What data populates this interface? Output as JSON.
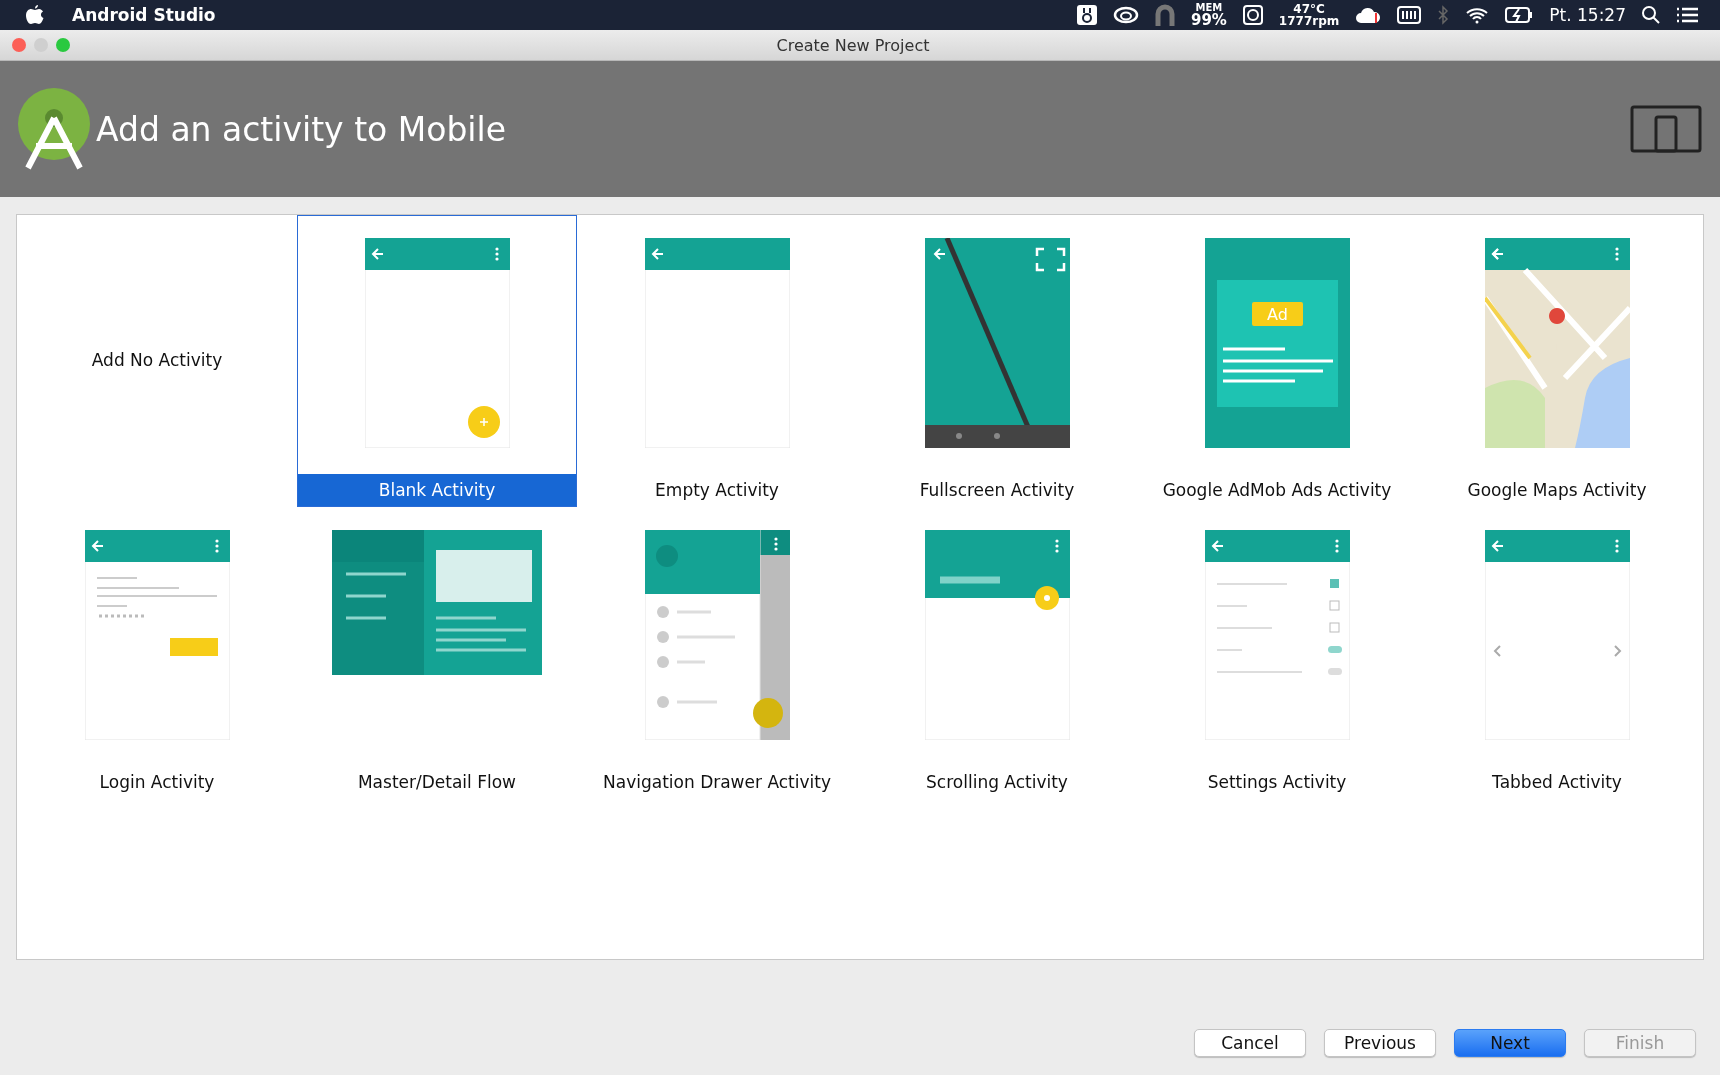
{
  "menu_bar": {
    "app_name": "Android Studio",
    "mem_label": "MEM",
    "mem_value": "99%",
    "temperature": "47°C",
    "fan_speed": "1777rpm",
    "clock": "Pt. 15:27"
  },
  "window": {
    "title": "Create New Project"
  },
  "header": {
    "title": "Add an activity to Mobile"
  },
  "templates": [
    {
      "label": "Add No Activity",
      "kind": "none",
      "selected": false
    },
    {
      "label": "Blank Activity",
      "kind": "blank",
      "selected": true
    },
    {
      "label": "Empty Activity",
      "kind": "empty",
      "selected": false
    },
    {
      "label": "Fullscreen Activity",
      "kind": "fullscreen",
      "selected": false
    },
    {
      "label": "Google AdMob Ads Activity",
      "kind": "admob",
      "selected": false,
      "badge": "Ad"
    },
    {
      "label": "Google Maps Activity",
      "kind": "maps",
      "selected": false
    },
    {
      "label": "Login Activity",
      "kind": "login",
      "selected": false
    },
    {
      "label": "Master/Detail Flow",
      "kind": "master_detail",
      "selected": false
    },
    {
      "label": "Navigation Drawer Activity",
      "kind": "nav_drawer",
      "selected": false
    },
    {
      "label": "Scrolling Activity",
      "kind": "scrolling",
      "selected": false
    },
    {
      "label": "Settings Activity",
      "kind": "settings",
      "selected": false
    },
    {
      "label": "Tabbed Activity",
      "kind": "tabbed",
      "selected": false
    }
  ],
  "buttons": [
    {
      "label": "Cancel",
      "primary": false,
      "disabled": false
    },
    {
      "label": "Previous",
      "primary": false,
      "disabled": false
    },
    {
      "label": "Next",
      "primary": true,
      "disabled": false
    },
    {
      "label": "Finish",
      "primary": false,
      "disabled": true
    }
  ]
}
